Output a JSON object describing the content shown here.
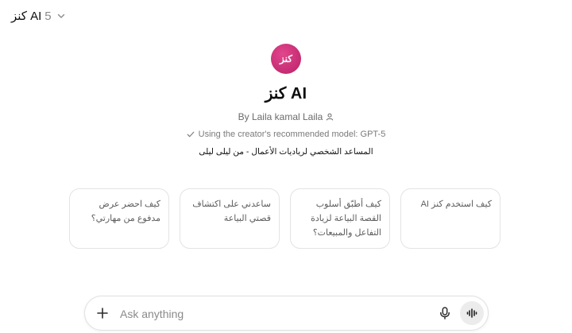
{
  "header": {
    "model_name": "كنز AI",
    "model_version": "5"
  },
  "gpt": {
    "avatar_text": "كنز",
    "title": "كنز AI",
    "byline": "By Laila kamal Laila",
    "model_note": "Using the creator's recommended model: GPT-5",
    "description": "المساعد الشخصي لرياديات الأعمال - من ليلى ليلى"
  },
  "suggestions": [
    {
      "text": "كيف احضر عرض مدفوع من مهارتي؟"
    },
    {
      "text": "ساعدني على اكتشاف قصتي البياعة"
    },
    {
      "text": "كيف أطبّق أسلوب القصة البياعة لزيادة التفاعل والمبيعات؟"
    },
    {
      "text": "كيف استخدم كنز AI"
    }
  ],
  "composer": {
    "placeholder": "Ask anything"
  },
  "icons": {
    "chevron": "chevron-down-icon",
    "person": "person-icon",
    "check": "check-icon",
    "plus": "plus-icon",
    "mic": "microphone-icon",
    "voice": "voice-waveform-icon"
  },
  "colors": {
    "avatar": "#d1377d",
    "card_border": "#e3e3e3",
    "voice_button_bg": "#ececec"
  }
}
